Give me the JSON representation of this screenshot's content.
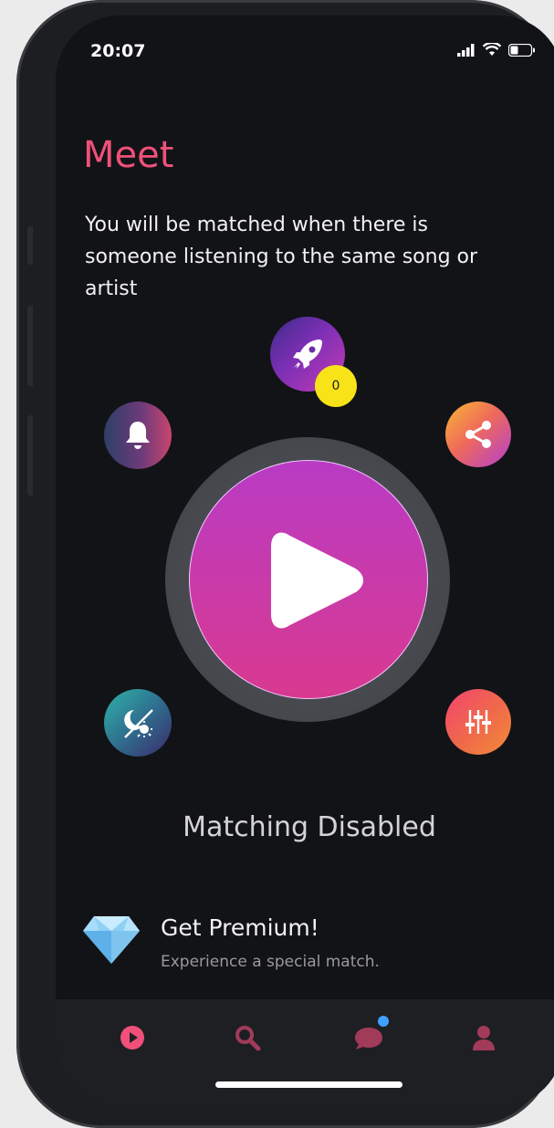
{
  "status_bar": {
    "time": "20:07",
    "signal_icon": "cellular-signal-icon",
    "wifi_icon": "wifi-icon",
    "battery_icon": "battery-icon"
  },
  "header": {
    "title": "Meet",
    "subtitle": "You will be matched when there is someone listening to the same song or artist"
  },
  "actions": {
    "boost": {
      "icon": "rocket-icon",
      "badge_count": "0"
    },
    "notifications": {
      "icon": "bell-icon"
    },
    "share": {
      "icon": "share-icon"
    },
    "theme": {
      "icon": "night-mode-icon"
    },
    "filters": {
      "icon": "sliders-icon"
    },
    "play": {
      "icon": "play-icon"
    }
  },
  "matching": {
    "status": "Matching Disabled"
  },
  "premium": {
    "icon": "diamond-icon",
    "title": "Get Premium!",
    "subtitle": "Experience a special match."
  },
  "tab_bar": {
    "tabs": [
      {
        "icon": "play-circle-icon",
        "active": true
      },
      {
        "icon": "search-icon",
        "active": false
      },
      {
        "icon": "chat-bubble-icon",
        "active": false,
        "has_notification_dot": true
      },
      {
        "icon": "profile-icon",
        "active": false
      }
    ]
  },
  "colors": {
    "accent": "#f0507a",
    "background": "#121316",
    "badge": "#f8e318",
    "notification_dot": "#3fa0ff",
    "play_gradient_top": "#b93bc4",
    "play_gradient_bottom": "#d9398f"
  }
}
